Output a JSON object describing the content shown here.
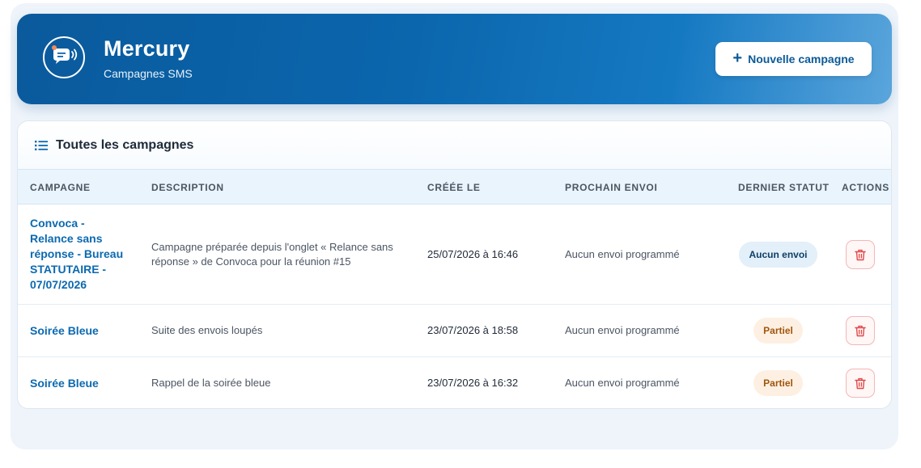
{
  "header": {
    "title": "Mercury",
    "subtitle": "Campagnes SMS",
    "new_campaign_label": "Nouvelle campagne"
  },
  "card": {
    "title": "Toutes les campagnes"
  },
  "table": {
    "columns": [
      "CAMPAGNE",
      "DESCRIPTION",
      "CRÉÉE LE",
      "PROCHAIN ENVOI",
      "DERNIER STATUT",
      "ACTIONS"
    ],
    "rows": [
      {
        "name_lines": [
          "Convoca -",
          "Relance sans",
          "réponse - Bureau",
          "STATUTAIRE -",
          "07/07/2026"
        ],
        "description_lines": [
          "Campagne préparée depuis l'onglet « Relance sans",
          "réponse » de Convoca pour la réunion #15"
        ],
        "created": "25/07/2026 à 16:46",
        "next_send": "Aucun envoi programmé",
        "status": "Aucun envoi"
      },
      {
        "name": "Soirée Bleue",
        "description": "Suite des envois loupés",
        "created": "23/07/2026 à 18:58",
        "next_send": "Aucun envoi programmé",
        "status": "Partiel"
      },
      {
        "name": "Soirée Bleue",
        "description": "Rappel de la soirée bleue",
        "created": "23/07/2026 à 16:32",
        "next_send": "Aucun envoi programmé",
        "status": "Partiel"
      }
    ]
  },
  "colors": {
    "brand": "#0b66ad",
    "link": "#0b69b0",
    "status_none_bg": "#e3eff9",
    "status_partial_bg": "#fdf0e3",
    "status_partial_text": "#a0560c",
    "danger": "#e04848"
  },
  "icons": {
    "logo": "sms-chat-icon",
    "new": "plus-icon",
    "list": "list-icon",
    "delete": "trash-icon"
  }
}
